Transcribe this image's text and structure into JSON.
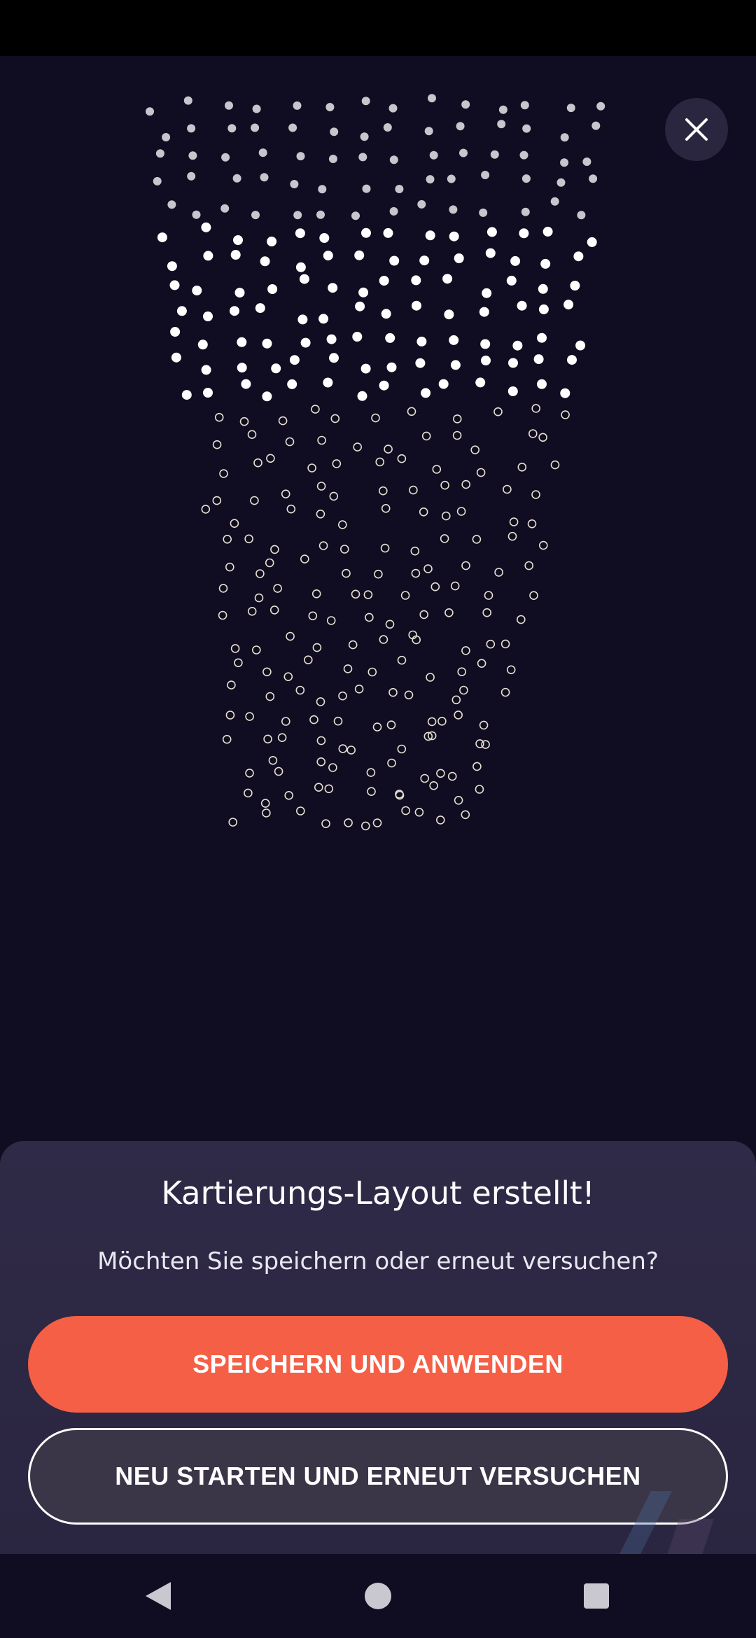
{
  "dialog": {
    "title": "Kartierungs-Layout erstellt!",
    "subtitle": "Möchten Sie speichern oder erneut versuchen?",
    "save_label": "SPEICHERN UND ANWENDEN",
    "restart_label": "NEU STARTEN UND ERNEUT VERSUCHEN"
  },
  "colors": {
    "background": "#100c21",
    "sheet": "#2f2a47",
    "accent": "#f55f46",
    "mapped_dot": "#ffffff",
    "pending_dot_outline": "#e6e0cf"
  },
  "icons": {
    "close": "close-icon",
    "back": "back-triangle-icon",
    "home": "home-circle-icon",
    "recents": "recents-square-icon"
  }
}
